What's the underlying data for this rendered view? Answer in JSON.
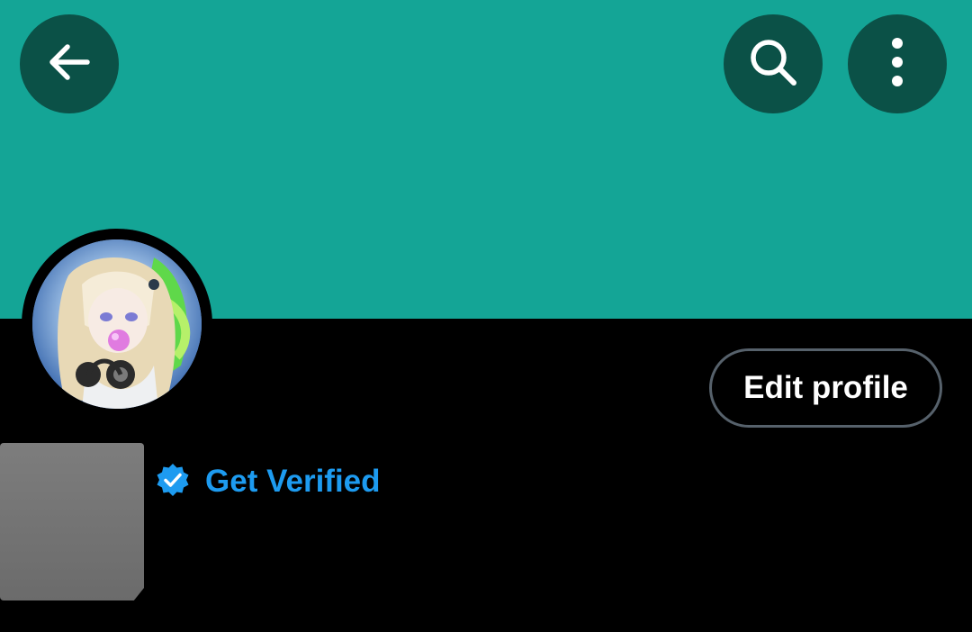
{
  "header": {
    "back_icon": "arrow-left-icon",
    "search_icon": "search-icon",
    "more_icon": "more-vertical-icon"
  },
  "colors": {
    "banner": "#14a596",
    "icon_button_bg": "#0b5147",
    "background": "#000000",
    "accent": "#1d9bf0",
    "button_border": "#56616b"
  },
  "profile": {
    "edit_profile_label": "Edit profile",
    "get_verified_label": "Get Verified",
    "verified_icon": "verified-badge-icon"
  }
}
